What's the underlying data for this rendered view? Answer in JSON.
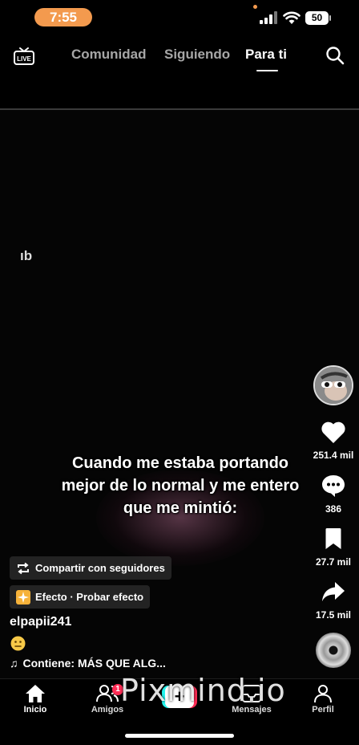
{
  "status_bar": {
    "time": "7:55",
    "battery": "50"
  },
  "top_nav": {
    "tabs": [
      {
        "label": "Comunidad"
      },
      {
        "label": "Siguiendo"
      },
      {
        "label": "Para ti"
      }
    ],
    "live_icon": "live-tv-icon",
    "search_icon": "search-icon"
  },
  "video": {
    "edge_text": "ıb",
    "caption": "Cuando me estaba portando mejor de lo normal y me entero que me mintió:"
  },
  "post": {
    "share_label": "Compartir con seguidores",
    "effect_label": "Efecto · Probar efecto",
    "username": "elpapii241",
    "emoji": "neutral-face-emoji",
    "music": "Contiene: MÁS QUE ALG..."
  },
  "actions": {
    "likes": "251.4 mil",
    "comments": "386",
    "saves": "27.7 mil",
    "shares": "17.5 mil"
  },
  "bottom_nav": {
    "items": [
      {
        "label": "Inicio"
      },
      {
        "label": "Amigos",
        "badge": "1"
      },
      {
        "label": ""
      },
      {
        "label": "Mensajes"
      },
      {
        "label": "Perfil"
      }
    ],
    "create_symbol": "+"
  },
  "watermark": "Pixmind.io",
  "colors": {
    "accent_pink": "#fe2c55",
    "accent_cyan": "#25f4ee",
    "status_orange": "#f39a4e"
  }
}
